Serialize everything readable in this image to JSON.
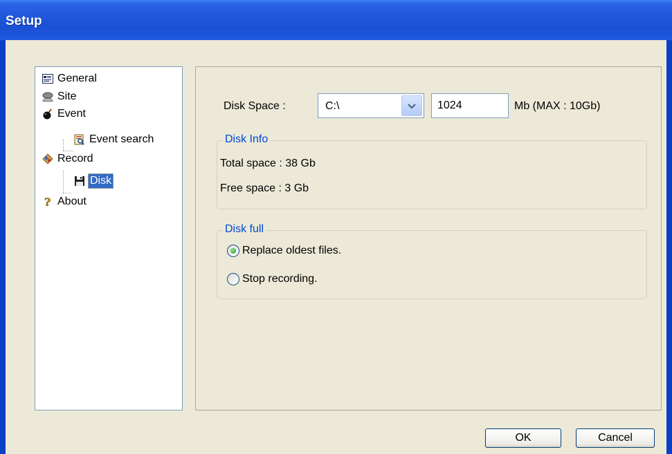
{
  "window": {
    "title": "Setup"
  },
  "tree": {
    "items": [
      {
        "label": "General",
        "icon": "general-settings-icon"
      },
      {
        "label": "Site",
        "icon": "site-icon"
      },
      {
        "label": "Event",
        "icon": "event-bomb-icon"
      },
      {
        "label": "Event search",
        "icon": "event-search-icon"
      },
      {
        "label": "Record",
        "icon": "record-icon"
      },
      {
        "label": "Disk",
        "icon": "floppy-disk-icon",
        "selected": true
      },
      {
        "label": "About",
        "icon": "question-icon"
      }
    ]
  },
  "disk": {
    "space_label": "Disk Space :",
    "drive_value": "C:\\",
    "size_value": "1024",
    "size_unit": "Mb (MAX : 10Gb)",
    "info": {
      "title": "Disk Info",
      "total": "Total space : 38 Gb",
      "free": "Free space : 3 Gb"
    },
    "full": {
      "title": "Disk full",
      "options": [
        {
          "label": "Replace oldest files.",
          "checked": true
        },
        {
          "label": "Stop recording.",
          "checked": false
        }
      ]
    }
  },
  "buttons": {
    "ok": "OK",
    "cancel": "Cancel"
  },
  "colors": {
    "title_bar": "#1f58dc",
    "selection": "#316ac5",
    "group_title": "#0046d5",
    "dialog_bg": "#ece9d8"
  }
}
